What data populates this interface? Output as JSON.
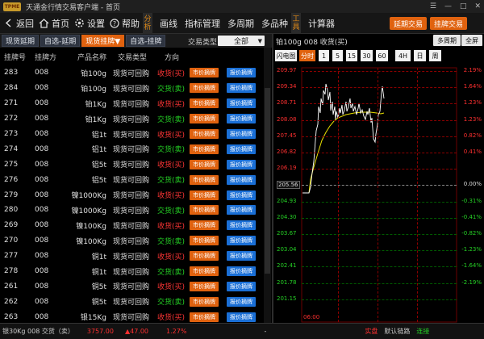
{
  "window": {
    "title": "天通金行情交易客户端 - 首页",
    "logo": "TPME"
  },
  "toolbar": {
    "back": "返回",
    "home": "首页",
    "settings": "设置",
    "help": "帮助",
    "vertical_label_1": "分析",
    "vertical_label_2": "工具",
    "items": [
      "画线",
      "指标管理",
      "多周期",
      "多品种"
    ],
    "calculator": "计算器",
    "btn_extend": "延期交易",
    "btn_listed": "挂牌交易"
  },
  "tabs": [
    "现货延期",
    "自选-延期",
    "现货挂牌▼",
    "自选-挂牌"
  ],
  "filter": {
    "label": "交易类型",
    "value": "全部"
  },
  "table": {
    "headers": [
      "挂牌号",
      "挂牌方",
      "产品名称",
      "交易类型",
      "方向"
    ],
    "btn_market": "市价摘牌",
    "btn_limit": "报价摘牌",
    "rows": [
      {
        "id": "283",
        "party": "008",
        "product": "铂100g",
        "type": "现货可回购",
        "dir": "收货(买)",
        "dir_color": "red"
      },
      {
        "id": "284",
        "party": "008",
        "product": "铂100g",
        "type": "现货可回购",
        "dir": "交货(卖)",
        "dir_color": "green"
      },
      {
        "id": "271",
        "party": "008",
        "product": "铂1Kg",
        "type": "现货可回购",
        "dir": "收货(买)",
        "dir_color": "red"
      },
      {
        "id": "272",
        "party": "008",
        "product": "铂1Kg",
        "type": "现货可回购",
        "dir": "交货(卖)",
        "dir_color": "green"
      },
      {
        "id": "273",
        "party": "008",
        "product": "铝1t",
        "type": "现货可回购",
        "dir": "收货(买)",
        "dir_color": "red"
      },
      {
        "id": "274",
        "party": "008",
        "product": "铝1t",
        "type": "现货可回购",
        "dir": "交货(卖)",
        "dir_color": "green"
      },
      {
        "id": "275",
        "party": "008",
        "product": "铝5t",
        "type": "现货可回购",
        "dir": "收货(买)",
        "dir_color": "red"
      },
      {
        "id": "276",
        "party": "008",
        "product": "铝5t",
        "type": "现货可回购",
        "dir": "交货(卖)",
        "dir_color": "green"
      },
      {
        "id": "279",
        "party": "008",
        "product": "镍1000Kg",
        "type": "现货可回购",
        "dir": "收货(买)",
        "dir_color": "red"
      },
      {
        "id": "280",
        "party": "008",
        "product": "镍1000Kg",
        "type": "现货可回购",
        "dir": "交货(卖)",
        "dir_color": "green"
      },
      {
        "id": "269",
        "party": "008",
        "product": "镍100Kg",
        "type": "现货可回购",
        "dir": "收货(买)",
        "dir_color": "red"
      },
      {
        "id": "270",
        "party": "008",
        "product": "镍100Kg",
        "type": "现货可回购",
        "dir": "交货(卖)",
        "dir_color": "green"
      },
      {
        "id": "277",
        "party": "008",
        "product": "铜1t",
        "type": "现货可回购",
        "dir": "收货(买)",
        "dir_color": "red"
      },
      {
        "id": "278",
        "party": "008",
        "product": "铜1t",
        "type": "现货可回购",
        "dir": "交货(卖)",
        "dir_color": "green"
      },
      {
        "id": "261",
        "party": "008",
        "product": "铜5t",
        "type": "现货可回购",
        "dir": "收货(买)",
        "dir_color": "red"
      },
      {
        "id": "262",
        "party": "008",
        "product": "铜5t",
        "type": "现货可回购",
        "dir": "交货(卖)",
        "dir_color": "green"
      },
      {
        "id": "263",
        "party": "008",
        "product": "银15Kg",
        "type": "现货可回购",
        "dir": "收货(买)",
        "dir_color": "red"
      }
    ]
  },
  "chart": {
    "title": "铂100g 008 收货(买)",
    "btn_multi": "多周期",
    "btn_full": "全屏",
    "periods": [
      "闪电图",
      "分时",
      "1",
      "5",
      "15",
      "30",
      "60",
      "4H",
      "日",
      "周"
    ],
    "active_period": "分时",
    "time_label": "06:00",
    "colors": {
      "price": "#ffffff",
      "avg": "#e8e000",
      "up": "#ff3030",
      "down": "#25d125",
      "grid": "#8b0000"
    },
    "left_labels": [
      "209.97",
      "209.34",
      "208.71",
      "208.08",
      "207.45",
      "206.82",
      "206.19",
      "205.56",
      "204.93",
      "204.30",
      "203.67",
      "203.04",
      "202.41",
      "201.78",
      "201.15"
    ],
    "right_labels": [
      "2.19%",
      "1.64%",
      "1.23%",
      "1.23%",
      "0.82%",
      "0.41%",
      "0.00%",
      "-0.31%",
      "-0.41%",
      "-0.82%",
      "-1.23%",
      "-1.64%",
      "-2.19%"
    ],
    "right_labels_full": [
      "2.19%",
      "1.64%",
      "1.23%",
      "1.23%",
      "0.82%",
      "0.41%",
      "",
      "0.00%",
      "-0.31%",
      "-0.41%",
      "-0.82%",
      "-1.23%",
      "-1.64%",
      "-2.19%"
    ],
    "ref_price": "205.56"
  },
  "status": {
    "product": "银30Kg 008 交货（卖）",
    "price": "3757.00",
    "change": "▲47.00",
    "pct": "1.27%",
    "dash": "-",
    "link1": "实盘",
    "link2": "默认链路",
    "conn": "连接"
  }
}
